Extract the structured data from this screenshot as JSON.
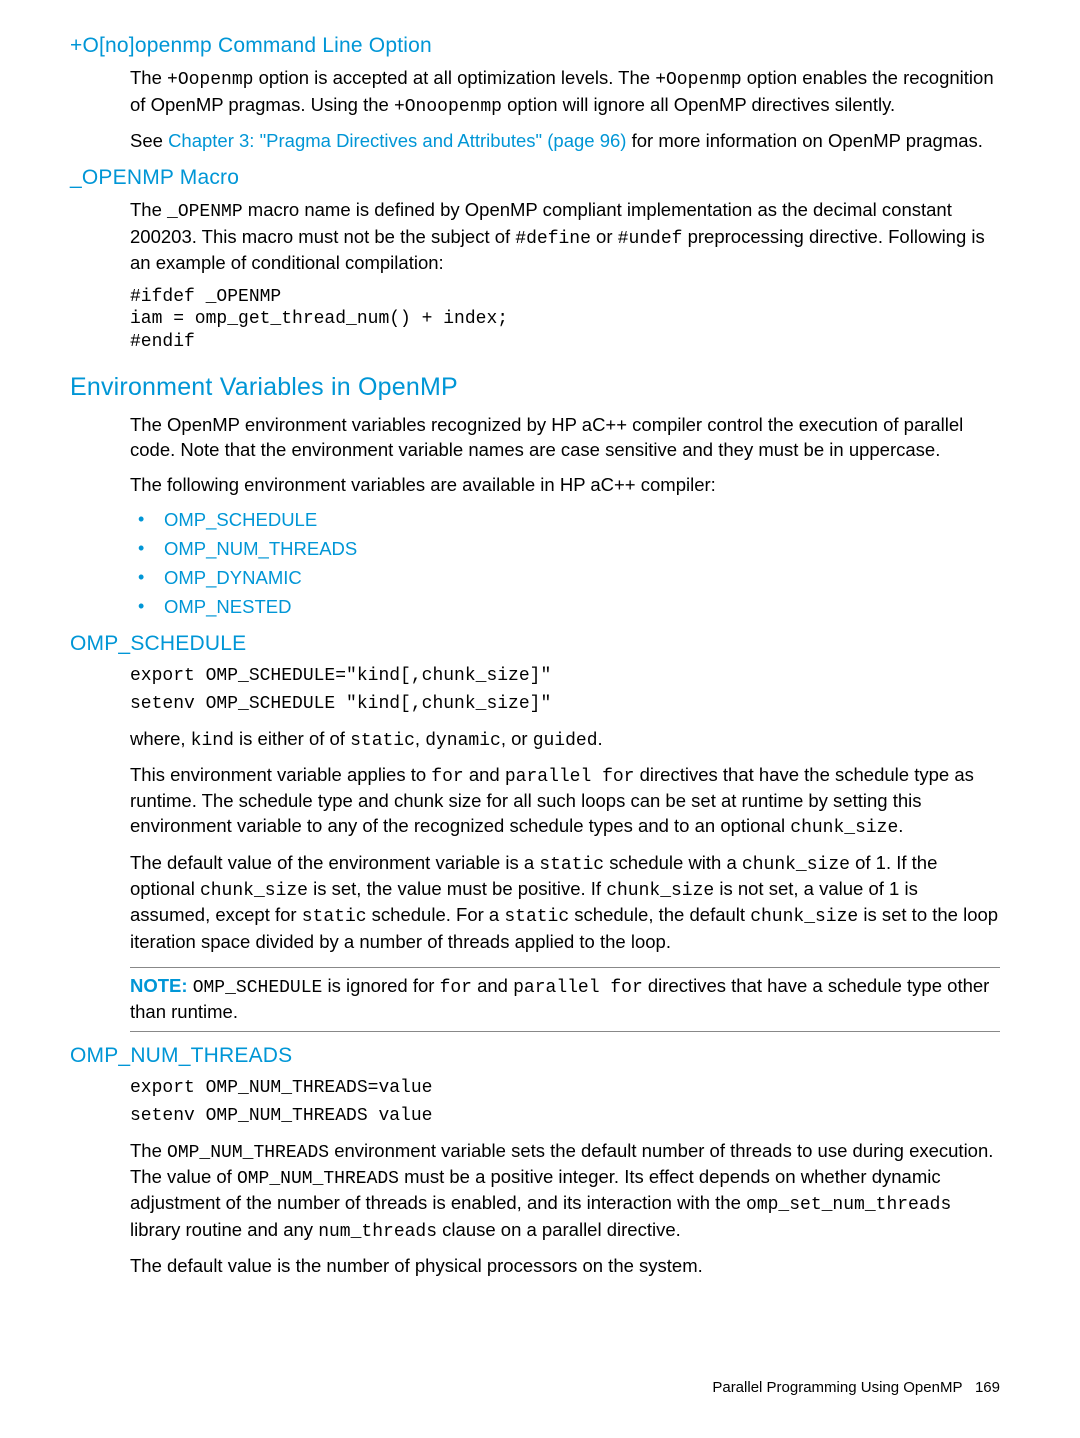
{
  "sections": {
    "ono": {
      "title": "+O[no]openmp Command Line Option",
      "p1a": "The ",
      "p1code1": "+Oopenmp",
      "p1b": " option is accepted at all optimization levels. The ",
      "p1code2": "+Oopenmp",
      "p1c": " option enables the recognition of OpenMP pragmas. Using the ",
      "p1code3": "+Onoopenmp",
      "p1d": " option will ignore all OpenMP directives silently.",
      "p2a": "See ",
      "p2link": "Chapter 3: \"Pragma Directives and Attributes\" (page 96)",
      "p2b": " for more information on OpenMP pragmas."
    },
    "macro": {
      "title": "_OPENMP Macro",
      "p1a": "The ",
      "p1code1": "_OPENMP",
      "p1b": " macro name is defined by OpenMP compliant implementation as the decimal constant 200203. This macro must not be the subject of ",
      "p1code2": "#define",
      "p1c": " or ",
      "p1code3": "#undef",
      "p1d": " preprocessing directive. Following is an example of conditional compilation:",
      "code": "#ifdef _OPENMP\niam = omp_get_thread_num() + index;\n#endif"
    },
    "env": {
      "title": "Environment Variables in OpenMP",
      "p1": "The OpenMP environment variables recognized by HP aC++ compiler control the execution of parallel code. Note that the environment variable names are case sensitive and they must be in uppercase.",
      "p2": "The following environment variables are available in HP aC++ compiler:",
      "items": [
        "OMP_SCHEDULE",
        "OMP_NUM_THREADS",
        "OMP_DYNAMIC",
        "OMP_NESTED"
      ]
    },
    "sched": {
      "title": "OMP_SCHEDULE",
      "code1": "export OMP_SCHEDULE=\"kind[,chunk_size]\"",
      "code2": "setenv OMP_SCHEDULE \"kind[,chunk_size]\"",
      "p1a": "where, ",
      "p1c1": "kind",
      "p1b": " is either of of ",
      "p1c2": "static",
      "p1c": ", ",
      "p1c3": "dynamic",
      "p1d": ", or ",
      "p1c4": "guided",
      "p1e": ".",
      "p2a": "This environment variable applies to ",
      "p2c1": "for",
      "p2b": " and ",
      "p2c2": "parallel for",
      "p2c": " directives that have the schedule type as runtime. The schedule type and chunk size for all such loops can be set at runtime by setting this environment variable to any of the recognized schedule types and to an optional ",
      "p2c3": "chunk_size",
      "p2d": ".",
      "p3a": "The default value of the environment variable is a ",
      "p3c1": "static",
      "p3b": " schedule with a ",
      "p3c2": "chunk_size",
      "p3c": " of 1. If the optional ",
      "p3c3": "chunk_size",
      "p3d": " is set, the value must be positive. If ",
      "p3c4": "chunk_size",
      "p3e": " is not set, a value of 1 is assumed, except for ",
      "p3c5": "static",
      "p3f": " schedule. For a ",
      "p3c6": "static",
      "p3g": " schedule, the default ",
      "p3c7": "chunk_size",
      "p3h": " is set to the loop iteration space divided by a number of threads applied to the loop.",
      "note_label": "NOTE:",
      "note_a": "   ",
      "note_c1": "OMP_SCHEDULE",
      "note_b": " is ignored for ",
      "note_c2": "for",
      "note_c": " and ",
      "note_c3": "parallel for",
      "note_d": " directives that have a schedule type other than runtime."
    },
    "num": {
      "title": "OMP_NUM_THREADS",
      "code1": "export OMP_NUM_THREADS=value",
      "code2": "setenv OMP_NUM_THREADS value",
      "p1a": "The ",
      "p1c1": "OMP_NUM_THREADS",
      "p1b": " environment variable sets the default number of threads to use during execution. The value of ",
      "p1c2": "OMP_NUM_THREADS",
      "p1c": " must be a positive integer. Its effect depends on whether dynamic adjustment of the number of threads is enabled, and its interaction with the ",
      "p1c3": "omp_set_num_threads",
      "p1d": " library routine and any ",
      "p1c4": "num_threads",
      "p1e": " clause on a parallel directive.",
      "p2": "The default value is the number of physical processors on the system."
    }
  },
  "footer": {
    "text": "Parallel Programming Using OpenMP",
    "page": "169"
  }
}
